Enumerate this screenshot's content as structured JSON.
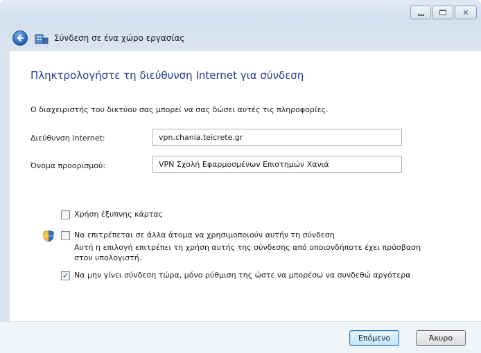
{
  "window": {
    "title": "Σύνδεση σε ένα χώρο εργασίας",
    "caption_buttons": [
      "minimize-icon",
      "maximize-icon",
      "close-icon"
    ]
  },
  "main": {
    "heading": "Πληκτρολογήστε τη διεύθυνση Internet για σύνδεση",
    "info": "Ο διαχειριστής του δικτύου σας μπορεί να σας δώσει αυτές τις πληροφορίες.",
    "internet_address": {
      "label": "Διεύθυνση Internet:",
      "value": "vpn.chania.teicrete.gr"
    },
    "destination_name": {
      "label": "Όνομα προορισμού:",
      "value": "VPN Σχολή Εφαρμοσμένων Επιστημών Χανιά"
    },
    "options": {
      "smart_card": {
        "label": "Χρήση έξυπνης κάρτας",
        "checked": false
      },
      "allow_others": {
        "label": "Να επιτρέπεται σε άλλα άτομα να χρησιμοποιούν αυτήν τη σύνδεση",
        "description_line1": "Αυτή η επιλογή επιτρέπει τη χρήση αυτής της σύνδεσης από οποιονδήποτε έχει πρόσβαση",
        "description_line2": "στον υπολογιστή.",
        "checked": false,
        "icon": "uac-shield-icon"
      },
      "dont_connect": {
        "label": "Να μην γίνει σύνδεση τώρα, μόνο ρύθμιση της ώστε να μπορέσω να συνδεθώ αργότερα",
        "checked": true
      }
    }
  },
  "footer": {
    "next_label": "Επόμενο",
    "cancel_label": "Άκυρο"
  },
  "colors": {
    "heading": "#1e3a8a",
    "frame": "#d9e4f1"
  }
}
